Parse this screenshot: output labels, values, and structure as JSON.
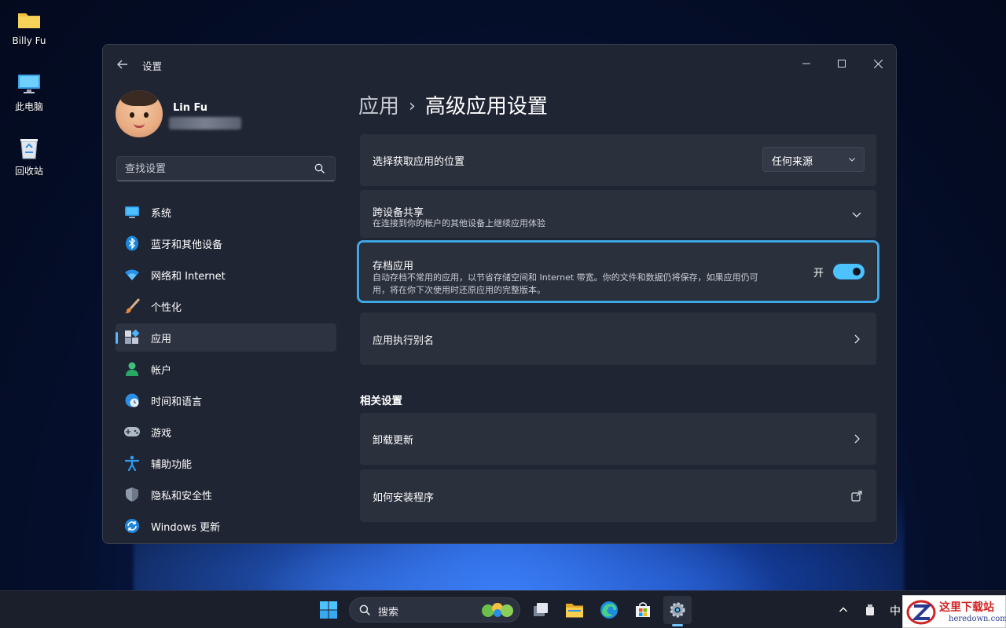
{
  "desktop": {
    "icons": [
      {
        "label": "Billy Fu",
        "icon": "folder-icon"
      },
      {
        "label": "此电脑",
        "icon": "computer-icon"
      },
      {
        "label": "回收站",
        "icon": "recycle-bin-icon"
      }
    ]
  },
  "window": {
    "title": "设置"
  },
  "profile": {
    "name": "Lin Fu"
  },
  "search": {
    "placeholder": "查找设置"
  },
  "sidebar": {
    "items": [
      {
        "label": "系统",
        "icon": "system-icon"
      },
      {
        "label": "蓝牙和其他设备",
        "icon": "bluetooth-icon"
      },
      {
        "label": "网络和 Internet",
        "icon": "wifi-icon"
      },
      {
        "label": "个性化",
        "icon": "brush-icon"
      },
      {
        "label": "应用",
        "icon": "apps-icon",
        "active": true
      },
      {
        "label": "帐户",
        "icon": "account-icon"
      },
      {
        "label": "时间和语言",
        "icon": "globe-clock-icon"
      },
      {
        "label": "游戏",
        "icon": "gamepad-icon"
      },
      {
        "label": "辅助功能",
        "icon": "accessibility-icon"
      },
      {
        "label": "隐私和安全性",
        "icon": "shield-icon"
      },
      {
        "label": "Windows 更新",
        "icon": "update-icon"
      }
    ]
  },
  "breadcrumb": {
    "parent": "应用",
    "separator": "›",
    "current": "高级应用设置"
  },
  "settings": {
    "source": {
      "title": "选择获取应用的位置",
      "value": "任何来源"
    },
    "share": {
      "title": "跨设备共享",
      "desc": "在连接到你的帐户的其他设备上继续应用体验"
    },
    "archive": {
      "title": "存档应用",
      "desc1": "自动存档不常用的应用，以节省存储空间和 Internet 带宽。你的文件和数据仍将保存，如果应用仍可",
      "desc2": "用，将在你下次使用时还原应用的完整版本。",
      "toggle_label": "开",
      "toggle_on": true
    },
    "alias": {
      "title": "应用执行别名"
    }
  },
  "related": {
    "title": "相关设置",
    "items": [
      {
        "title": "卸载更新"
      },
      {
        "title": "如何安装程序"
      }
    ]
  },
  "taskbar": {
    "search_label": "搜索",
    "ime": "中"
  },
  "watermark": {
    "text": "这里下载站",
    "url": "heredown.com"
  },
  "colors": {
    "accent": "#4cc2ff",
    "highlight": "#3fa7e6",
    "window_bg": "#202534",
    "card_bg": "#2b303d"
  }
}
